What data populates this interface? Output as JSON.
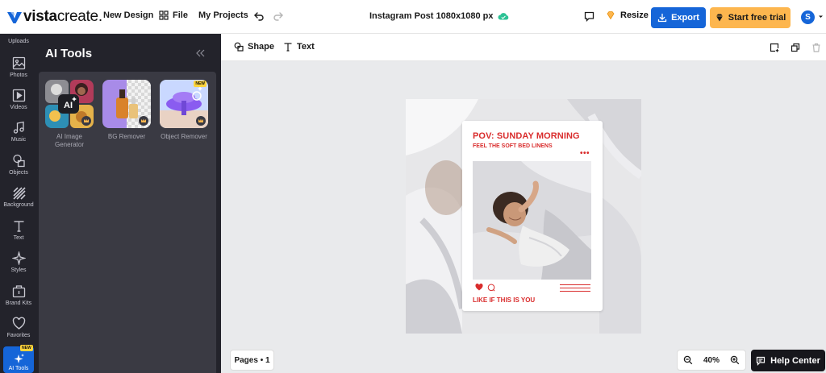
{
  "brand": {
    "logo_bold": "vista",
    "logo_light": "create",
    "logo_suffix": "."
  },
  "topbar": {
    "new_design": "New Design",
    "file": "File",
    "my_projects": "My Projects",
    "doc_title": "Instagram Post 1080x1080 px",
    "resize": "Resize",
    "export": "Export",
    "start_trial": "Start free trial",
    "avatar_initial": "S"
  },
  "rail": {
    "uploads": "Uploads",
    "items": [
      "Photos",
      "Videos",
      "Music",
      "Objects",
      "Background",
      "Text",
      "Styles",
      "Brand Kits",
      "Favorites"
    ],
    "active": "AI Tools",
    "active_badge": "NEW"
  },
  "panel": {
    "title": "AI Tools",
    "tools": [
      {
        "label": "AI Image Generator",
        "badge": ""
      },
      {
        "label": "BG Remover",
        "badge": ""
      },
      {
        "label": "Object Remover",
        "badge": "NEW"
      }
    ]
  },
  "canvas_toolbar": {
    "shape": "Shape",
    "text": "Text"
  },
  "post": {
    "title": "POV: SUNDAY MORNING",
    "subtitle": "FEEL THE SOFT BED LINENS",
    "dots": "•••",
    "cta": "LIKE IF THIS IS YOU"
  },
  "bottom": {
    "pages": "Pages • 1",
    "zoom": "40%",
    "help": "Help Center"
  },
  "colors": {
    "accent_blue": "#1565d8",
    "trial_orange": "#fdb64e",
    "post_red": "#d92c2c",
    "sidebar_dark": "#23232b"
  }
}
